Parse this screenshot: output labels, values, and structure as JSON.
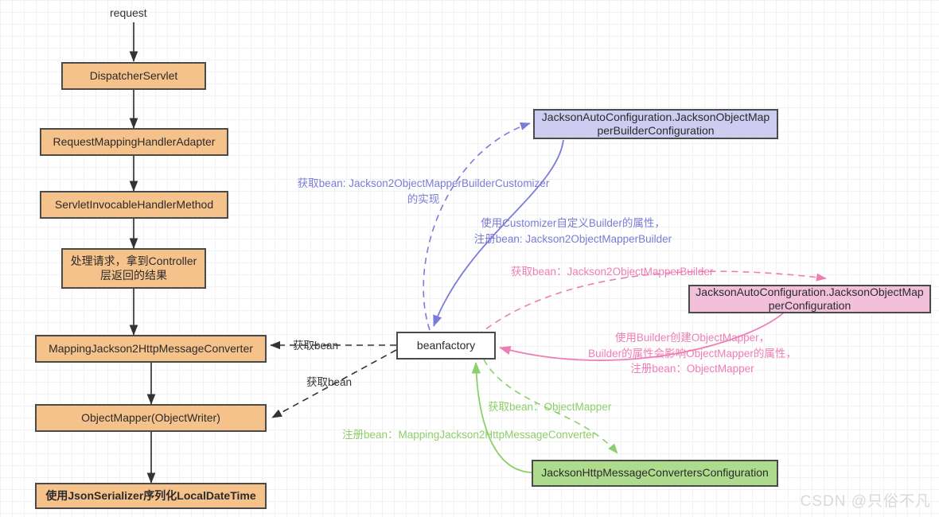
{
  "diagram": {
    "title_text": "request",
    "watermark": "CSDN @只俗不凡",
    "colors": {
      "orange": "#f6c28b",
      "blue": "#cdcdf2",
      "pink": "#f3c0dc",
      "green": "#aedb8e",
      "white": "#ffffff",
      "border": "#4a4a4a",
      "black_edge": "#333333",
      "purple_edge": "#7b7bd8",
      "pink_edge": "#ef7db5",
      "green_edge": "#8dcf6a",
      "grid_minor": "#f2f2f2",
      "grid_major": "#e8e8e8"
    },
    "nodes": [
      {
        "id": "dispatcher",
        "label": "DispatcherServlet",
        "color": "orange"
      },
      {
        "id": "adapter",
        "label": "RequestMappingHandlerAdapter",
        "color": "orange"
      },
      {
        "id": "invocable",
        "label": "ServletInvocableHandlerMethod",
        "color": "orange"
      },
      {
        "id": "process",
        "label": "处理请求，拿到Controller\n层返回的结果",
        "color": "orange"
      },
      {
        "id": "converter",
        "label": "MappingJackson2HttpMessageConverter",
        "color": "orange"
      },
      {
        "id": "objectmapper",
        "label": "ObjectMapper(ObjectWriter)",
        "color": "orange"
      },
      {
        "id": "serializer",
        "label": "使用JsonSerializer序列化LocalDateTime",
        "color": "orange"
      },
      {
        "id": "beanfactory",
        "label": "beanfactory",
        "color": "white"
      },
      {
        "id": "builderconfig",
        "label": "JacksonAutoConfiguration.JacksonObjectMap\nperBuilderConfiguration",
        "color": "blue"
      },
      {
        "id": "mapperconfig",
        "label": "JacksonAutoConfiguration.JacksonObjectMap\nperConfiguration",
        "color": "pink"
      },
      {
        "id": "httpconverters",
        "label": "JacksonHttpMessageConvertersConfiguration",
        "color": "green"
      }
    ],
    "edge_labels": [
      {
        "id": "get-bean-converter",
        "text": "获取bean",
        "color": "black"
      },
      {
        "id": "get-bean-objectmapper",
        "text": "获取bean",
        "color": "black"
      },
      {
        "id": "get-customizer",
        "text": "获取bean: Jackson2ObjectMapperBuilderCustomizer\n的实现",
        "color": "purple"
      },
      {
        "id": "use-customizer",
        "text": "使用Customizer自定义Builder的属性，\n注册bean: Jackson2ObjectMapperBuilder",
        "color": "purple"
      },
      {
        "id": "get-builder",
        "text": "获取bean：Jackson2ObjectMapperBuilder",
        "color": "pink"
      },
      {
        "id": "use-builder",
        "text": "使用Builder创建ObjectMapper，\nBuilder的属性会影响ObjectMapper的属性，\n注册bean：ObjectMapper",
        "color": "pink"
      },
      {
        "id": "get-objectmapper",
        "text": "获取bean：ObjectMapper",
        "color": "green"
      },
      {
        "id": "register-converter",
        "text": "注册bean：MappingJackson2HttpMessageConverter",
        "color": "green"
      }
    ]
  }
}
